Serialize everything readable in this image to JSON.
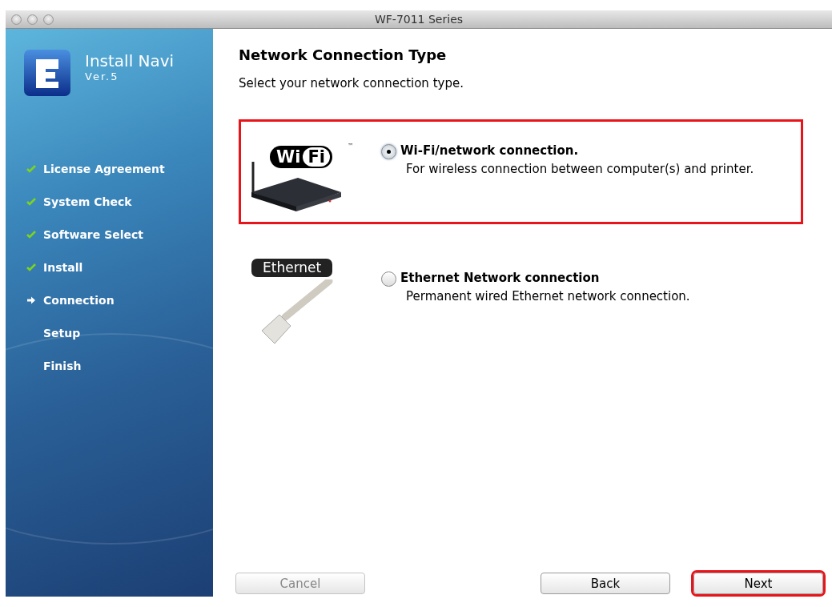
{
  "window": {
    "title": "WF-7011 Series"
  },
  "sidebar": {
    "app_name": "Install Navi",
    "version": "Ver.5",
    "steps": [
      {
        "label": "License Agreement",
        "done": true,
        "current": false
      },
      {
        "label": "System Check",
        "done": true,
        "current": false
      },
      {
        "label": "Software Select",
        "done": true,
        "current": false
      },
      {
        "label": "Install",
        "done": true,
        "current": false
      },
      {
        "label": "Connection",
        "done": false,
        "current": true
      },
      {
        "label": "Setup",
        "done": false,
        "current": false
      },
      {
        "label": "Finish",
        "done": false,
        "current": false
      }
    ]
  },
  "heading": "Network Connection Type",
  "instruction": "Select your network connection type.",
  "options": [
    {
      "kind": "wifi",
      "logo_text": [
        "Wi",
        "Fi"
      ],
      "trademark": "™",
      "label": "Wi-Fi/network connection.",
      "description": "For wireless connection between computer(s) and printer.",
      "selected": true,
      "highlighted": true
    },
    {
      "kind": "ethernet",
      "logo_text": [
        "Ethernet"
      ],
      "label": "Ethernet Network connection",
      "description": "Permanent wired Ethernet network connection.",
      "selected": false,
      "highlighted": false
    }
  ],
  "buttons": [
    {
      "label": "Cancel",
      "disabled": true,
      "highlighted": false
    },
    {
      "label": "Back",
      "disabled": false,
      "highlighted": false
    },
    {
      "label": "Next",
      "disabled": false,
      "highlighted": true
    }
  ]
}
